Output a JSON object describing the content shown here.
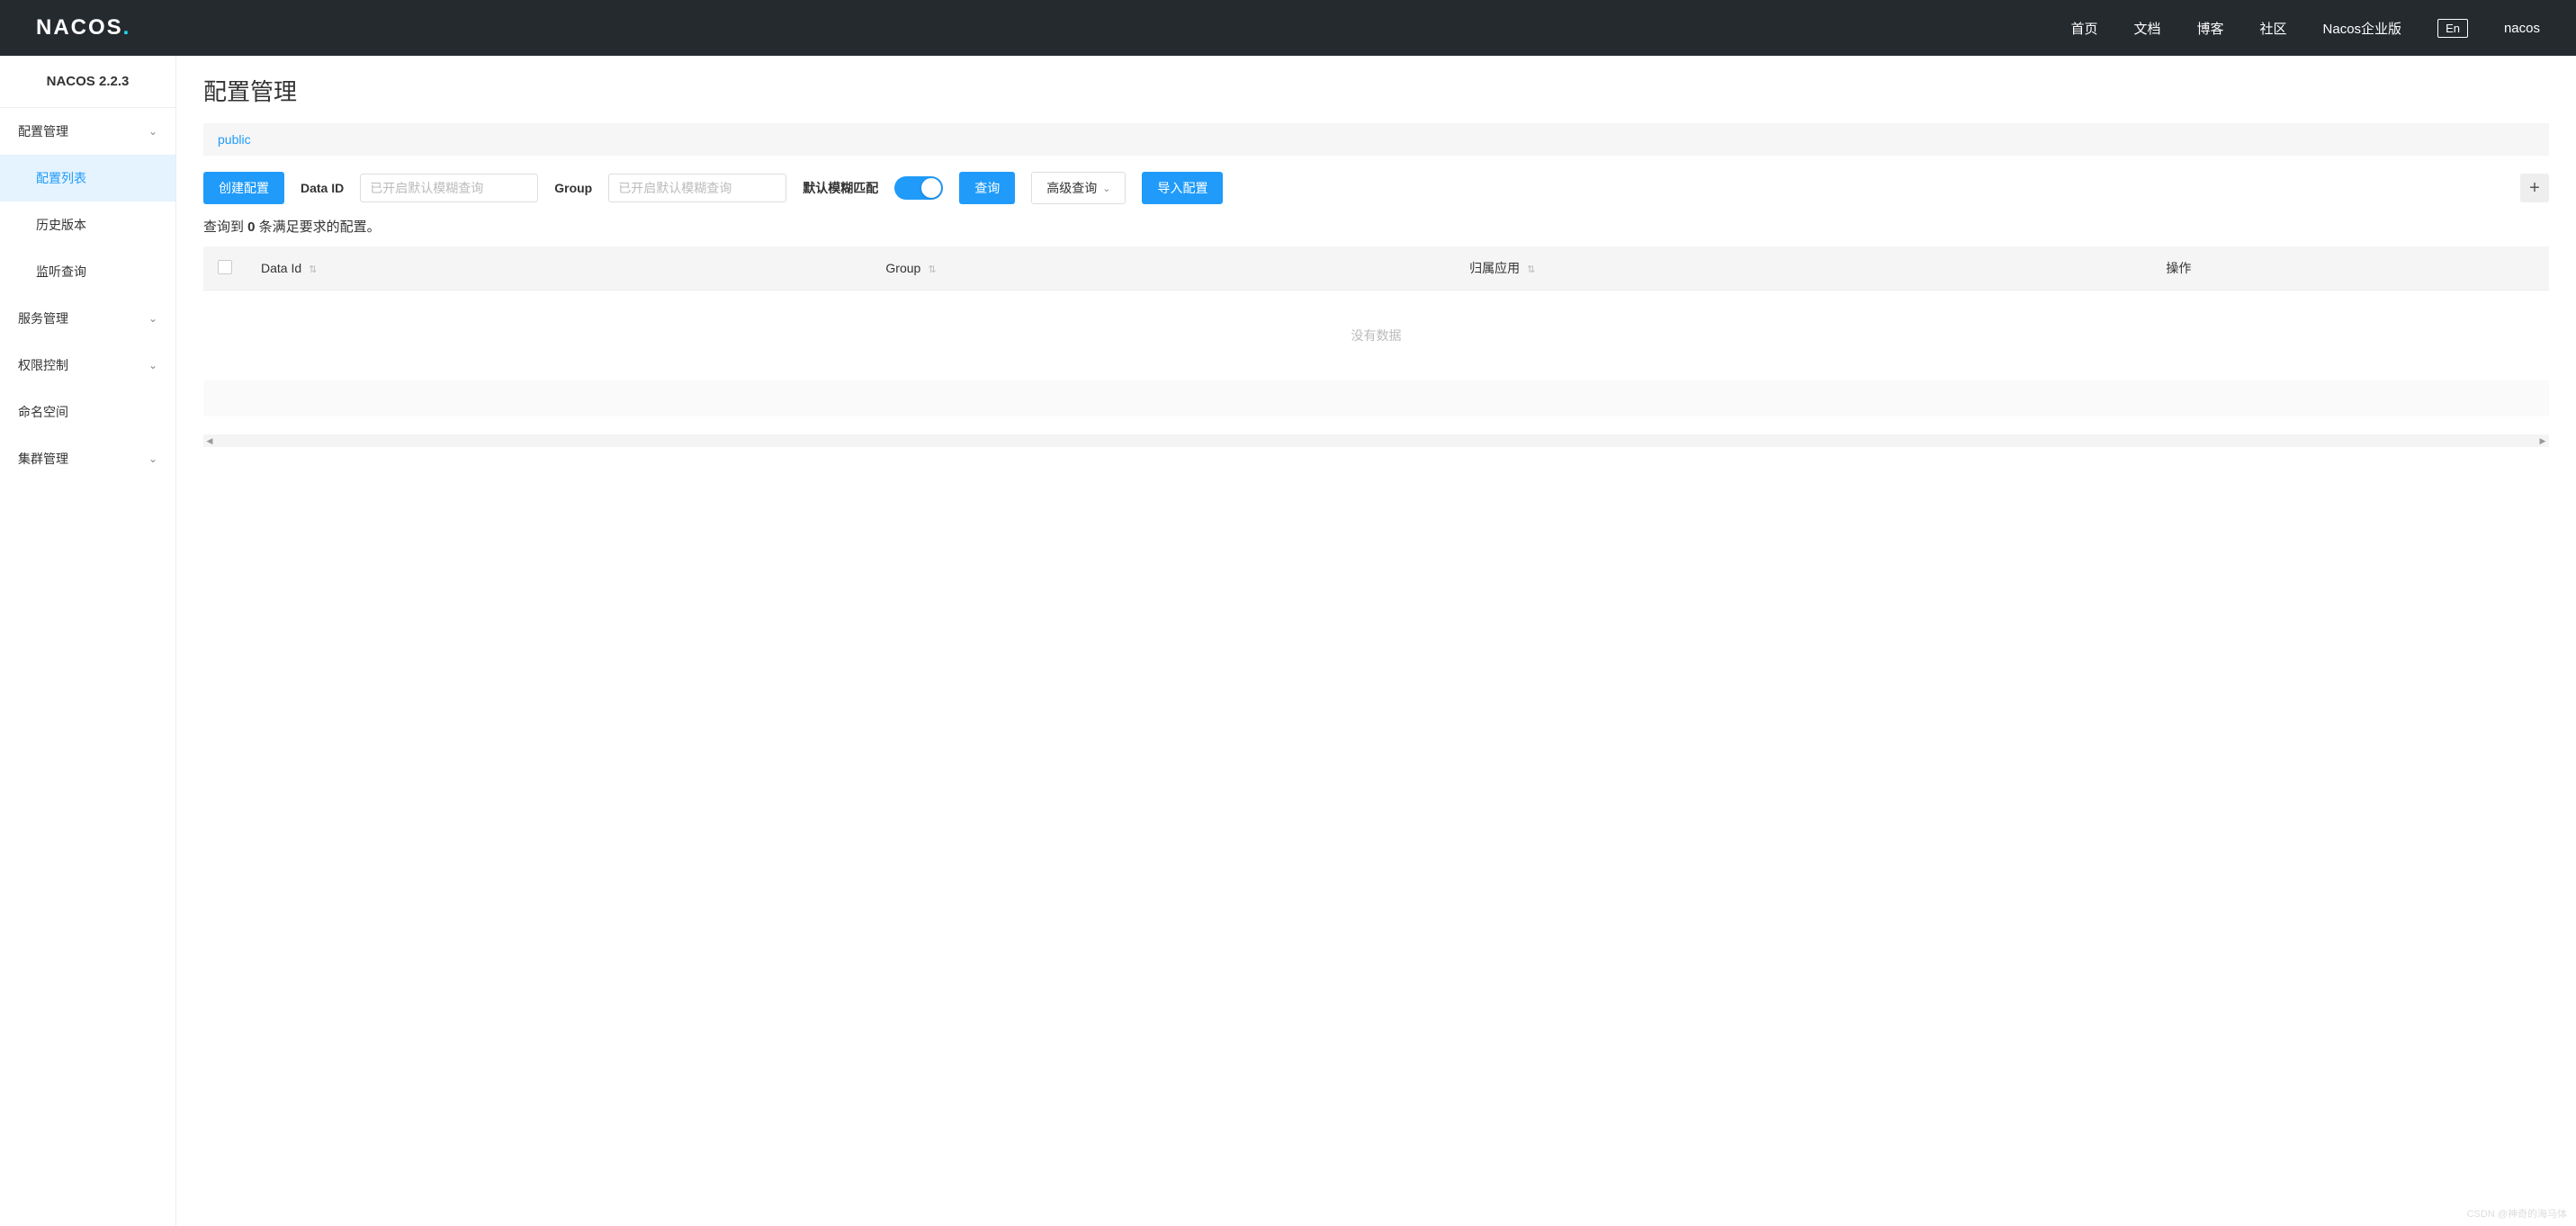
{
  "header": {
    "logo_main": "NACOS",
    "logo_dot": ".",
    "nav": {
      "home": "首页",
      "docs": "文档",
      "blog": "博客",
      "community": "社区",
      "enterprise": "Nacos企业版"
    },
    "lang": "En",
    "user": "nacos"
  },
  "sidebar": {
    "title": "NACOS 2.2.3",
    "items": [
      {
        "label": "配置管理",
        "expandable": true
      },
      {
        "label": "配置列表",
        "sub": true,
        "active": true
      },
      {
        "label": "历史版本",
        "sub": true
      },
      {
        "label": "监听查询",
        "sub": true
      },
      {
        "label": "服务管理",
        "expandable": true
      },
      {
        "label": "权限控制",
        "expandable": true
      },
      {
        "label": "命名空间"
      },
      {
        "label": "集群管理",
        "expandable": true
      }
    ]
  },
  "main": {
    "title": "配置管理",
    "namespace": "public",
    "toolbar": {
      "create": "创建配置",
      "data_id_label": "Data ID",
      "data_id_placeholder": "已开启默认模糊查询",
      "group_label": "Group",
      "group_placeholder": "已开启默认模糊查询",
      "fuzzy_label": "默认模糊匹配",
      "query": "查询",
      "advanced": "高级查询",
      "import": "导入配置"
    },
    "result": {
      "prefix": "查询到 ",
      "count": "0",
      "suffix": " 条满足要求的配置。"
    },
    "table": {
      "headers": {
        "data_id": "Data Id",
        "group": "Group",
        "app": "归属应用",
        "ops": "操作"
      },
      "empty": "没有数据"
    }
  },
  "watermark": "CSDN @神奇的海马体"
}
